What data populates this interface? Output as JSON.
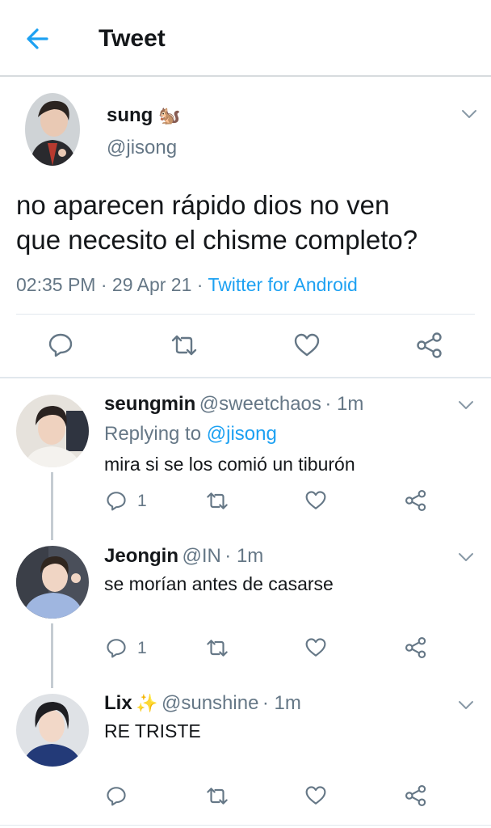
{
  "header": {
    "title": "Tweet"
  },
  "main_tweet": {
    "name": "sung",
    "emoji": "🐿️",
    "handle": "@jisong",
    "text_line1": "no aparecen rápido dios no ven",
    "text_line2": "que necesito el chisme completo?",
    "time": "02:35 PM",
    "sep1": "·",
    "date": "29 Apr 21",
    "sep2": "·",
    "source": "Twitter for Android"
  },
  "replies": [
    {
      "name": "seungmin",
      "handle": "@sweetchaos",
      "time": "· 1m",
      "replying_prefix": "Replying to",
      "replying_handle": "@jisong",
      "text": "mira si se los comió un tiburón",
      "reply_count": "1"
    },
    {
      "name": "Jeongin",
      "handle": "@IN",
      "time": "· 1m",
      "text": "se morían antes de casarse",
      "reply_count": "1"
    },
    {
      "name": "Lix",
      "emoji": "✨",
      "handle": "@sunshine",
      "time": "· 1m",
      "text": "RE TRISTE"
    }
  ],
  "colors": {
    "accent": "#1da1f2",
    "muted": "#657786",
    "text": "#14171a",
    "divider": "#e1e8ed"
  }
}
